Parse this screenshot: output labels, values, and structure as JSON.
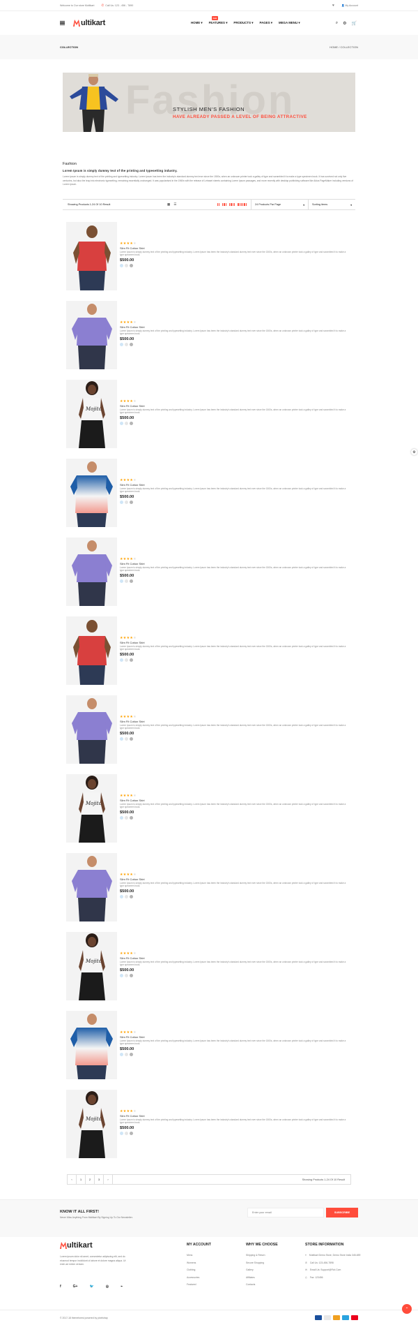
{
  "topbar": {
    "welcome": "Welcome to Our store Multikart",
    "phone": "Call Us: 123 - 456 - 7890",
    "account": "My Account"
  },
  "nav": {
    "items": [
      "HOME",
      "FEATURES",
      "PRODUCTS",
      "PAGES",
      "MEGA MENU"
    ],
    "new_badge": "new"
  },
  "logo": {
    "text": "ultikart",
    "accent": "#ff4c3b"
  },
  "breadcrumb": {
    "page": "COLLECTION",
    "home": "HOME",
    "sep": "/",
    "current": "COLLECTION"
  },
  "banner": {
    "bg_text": "Fashion",
    "title": "STYLISH MEN'S FASHION",
    "subtitle": "HAVE ALREADY PASSED A LEVEL OF BEING ATTRACTIVE"
  },
  "intro": {
    "heading": "Fashion",
    "subheading": "Lorem Ipsum is simply dummy text of the printing and typesetting industry.",
    "body": "Lorem Ipsum is simply dummy text of the printing and typesetting industry. Lorem Ipsum has been the industry's standard dummy text ever since the 1500s, when an unknown printer took a galley of type and scrambled it to make a type specimen book. It has survived not only five centuries, but also the leap into electronic typesetting, remaining essentially unchanged. It was popularised in the 1960s with the release of Letraset sheets containing Lorem Ipsum passages, and more recently with desktop publishing software like Aldus PageMaker including versions of Lorem Ipsum."
  },
  "filter": {
    "showing": "Showing Products 1-24 Of 10 Result",
    "per_page": "24 Products Par Page",
    "sort": "Sorting items"
  },
  "products": [
    {
      "image": "man-red-polo",
      "stars": 4,
      "name": "Slim Fit Cotton Shirt",
      "desc": "Lorem Ipsum is simply dummy text of the printing and typesetting industry. Lorem Ipsum has been the industry's standard dummy text ever since the 1500s, when an unknown printer took a galley of type and scrambled it to make a type specimen book.",
      "price": "$500.00"
    },
    {
      "image": "man-purple-polo",
      "stars": 4,
      "name": "Slim Fit Cotton Shirt",
      "desc": "Lorem Ipsum is simply dummy text of the printing and typesetting industry. Lorem Ipsum has been the industry's standard dummy text ever since the 1500s, when an unknown printer took a galley of type and scrambled it to make a type specimen book.",
      "price": "$500.00"
    },
    {
      "image": "woman-white-tank",
      "stars": 4,
      "name": "Slim Fit Cotton Shirt",
      "desc": "Lorem Ipsum is simply dummy text of the printing and typesetting industry. Lorem Ipsum has been the industry's standard dummy text ever since the 1500s, when an unknown printer took a galley of type and scrambled it to make a type specimen book.",
      "price": "$500.00"
    },
    {
      "image": "man-blue-gradient-polo",
      "stars": 4,
      "name": "Slim Fit Cotton Shirt",
      "desc": "Lorem Ipsum is simply dummy text of the printing and typesetting industry. Lorem Ipsum has been the industry's standard dummy text ever since the 1500s, when an unknown printer took a galley of type and scrambled it to make a type specimen book.",
      "price": "$500.00"
    },
    {
      "image": "man-purple-polo",
      "stars": 4,
      "name": "Slim Fit Cotton Shirt",
      "desc": "Lorem Ipsum is simply dummy text of the printing and typesetting industry. Lorem Ipsum has been the industry's standard dummy text ever since the 1500s, when an unknown printer took a galley of type and scrambled it to make a type specimen book.",
      "price": "$500.00"
    },
    {
      "image": "man-red-polo",
      "stars": 4,
      "name": "Slim Fit Cotton Shirt",
      "desc": "Lorem Ipsum is simply dummy text of the printing and typesetting industry. Lorem Ipsum has been the industry's standard dummy text ever since the 1500s, when an unknown printer took a galley of type and scrambled it to make a type specimen book.",
      "price": "$500.00"
    },
    {
      "image": "man-purple-polo",
      "stars": 4,
      "name": "Slim Fit Cotton Shirt",
      "desc": "Lorem Ipsum is simply dummy text of the printing and typesetting industry. Lorem Ipsum has been the industry's standard dummy text ever since the 1500s, when an unknown printer took a galley of type and scrambled it to make a type specimen book.",
      "price": "$500.00"
    },
    {
      "image": "woman-white-tank",
      "stars": 4,
      "name": "Slim Fit Cotton Shirt",
      "desc": "Lorem Ipsum is simply dummy text of the printing and typesetting industry. Lorem Ipsum has been the industry's standard dummy text ever since the 1500s, when an unknown printer took a galley of type and scrambled it to make a type specimen book.",
      "price": "$500.00"
    },
    {
      "image": "man-purple-polo",
      "stars": 4,
      "name": "Slim Fit Cotton Shirt",
      "desc": "Lorem Ipsum is simply dummy text of the printing and typesetting industry. Lorem Ipsum has been the industry's standard dummy text ever since the 1500s, when an unknown printer took a galley of type and scrambled it to make a type specimen book.",
      "price": "$500.00"
    },
    {
      "image": "woman-white-tank",
      "stars": 4,
      "name": "Slim Fit Cotton Shirt",
      "desc": "Lorem Ipsum is simply dummy text of the printing and typesetting industry. Lorem Ipsum has been the industry's standard dummy text ever since the 1500s, when an unknown printer took a galley of type and scrambled it to make a type specimen book.",
      "price": "$500.00"
    },
    {
      "image": "man-blue-gradient-polo",
      "stars": 4,
      "name": "Slim Fit Cotton Shirt",
      "desc": "Lorem Ipsum is simply dummy text of the printing and typesetting industry. Lorem Ipsum has been the industry's standard dummy text ever since the 1500s, when an unknown printer took a galley of type and scrambled it to make a type specimen book.",
      "price": "$500.00"
    },
    {
      "image": "woman-white-tank",
      "stars": 4,
      "name": "Slim Fit Cotton Shirt",
      "desc": "Lorem Ipsum is simply dummy text of the printing and typesetting industry. Lorem Ipsum has been the industry's standard dummy text ever since the 1500s, when an unknown printer took a galley of type and scrambled it to make a type specimen book.",
      "price": "$500.00"
    }
  ],
  "swatch_colors": [
    "#d0e6f7",
    "#e6e6e6",
    "#b5b5b5"
  ],
  "pager": {
    "prev": "‹",
    "pages": [
      "1",
      "2",
      "3"
    ],
    "next": "›",
    "info": "Showing Products 1-24 Of 10 Result"
  },
  "newsletter": {
    "title": "KNOW IT ALL FIRST!",
    "subtitle": "Never Miss Anything From Multikart By Signing Up To Our Newsletter.",
    "placeholder": "Enter your email",
    "button": "SUBSCRIBE"
  },
  "footer": {
    "about": "Lorem ipsum dolor sit amet, consectetur adipiscing elit, sed do eiusmod tempor incididunt ut labore et dolore magna aliqua. Ut enim ad minim veniam.",
    "social": [
      "f",
      "G+",
      "t",
      "ig",
      "rss"
    ],
    "my_account": {
      "title": "MY ACCOUNT",
      "links": [
        "Mens",
        "Womens",
        "Clothing",
        "Accessories",
        "Featured"
      ]
    },
    "why": {
      "title": "WHY WE CHOOSE",
      "links": [
        "Shipping & Return",
        "Secure Shopping",
        "Gallery",
        "Affiliates",
        "Contacts"
      ]
    },
    "store": {
      "title": "STORE INFORMATION",
      "address": "Multikart Demo Store, Demo Store India 345-659",
      "phone": "Call Us: 123-456-7898",
      "email": "Email Us: Support@Fiot.Com",
      "fax": "Fax: 123456"
    },
    "copyright": "© 2017-18 themeforest powered by pixelstrap"
  },
  "payment_colors": [
    "#1a4f9c",
    "#e8e8e8",
    "#f0a020",
    "#2aa3df",
    "#eb001b"
  ]
}
